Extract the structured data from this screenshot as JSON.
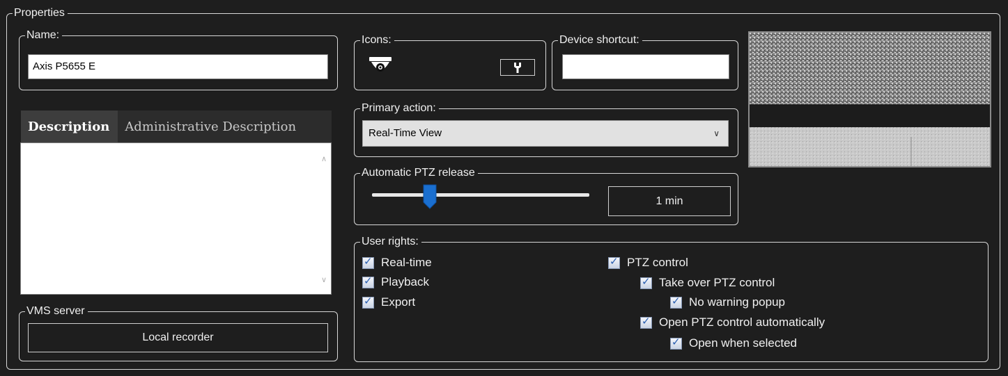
{
  "properties": {
    "title": "Properties"
  },
  "name": {
    "label": "Name:",
    "value": "Axis P5655 E"
  },
  "icons": {
    "label": "Icons:",
    "camera_icon": "dome-camera-icon",
    "edit_icon": "wrench-icon"
  },
  "device_shortcut": {
    "label": "Device shortcut:",
    "value": ""
  },
  "description_tabs": [
    {
      "label": "Description",
      "active": true
    },
    {
      "label": "Administrative Description",
      "active": false
    }
  ],
  "description": {
    "value": ""
  },
  "primary_action": {
    "label": "Primary action:",
    "selected": "Real-Time View"
  },
  "ptz_release": {
    "label": "Automatic PTZ release",
    "value": "1 min",
    "slider_fraction": 0.27
  },
  "vms_server": {
    "label": "VMS server",
    "button": "Local recorder"
  },
  "user_rights": {
    "label": "User rights:",
    "realtime": "Real-time",
    "playback": "Playback",
    "export": "Export",
    "ptz_control": "PTZ control",
    "take_over": "Take over PTZ control",
    "no_warning": "No warning popup",
    "open_auto": "Open PTZ control automatically",
    "open_selected": "Open when selected"
  },
  "colors": {
    "background": "#1e1e1e",
    "border": "#d8d8d8",
    "thumb": "#1a6fd0",
    "check": "#2a5fb0"
  }
}
